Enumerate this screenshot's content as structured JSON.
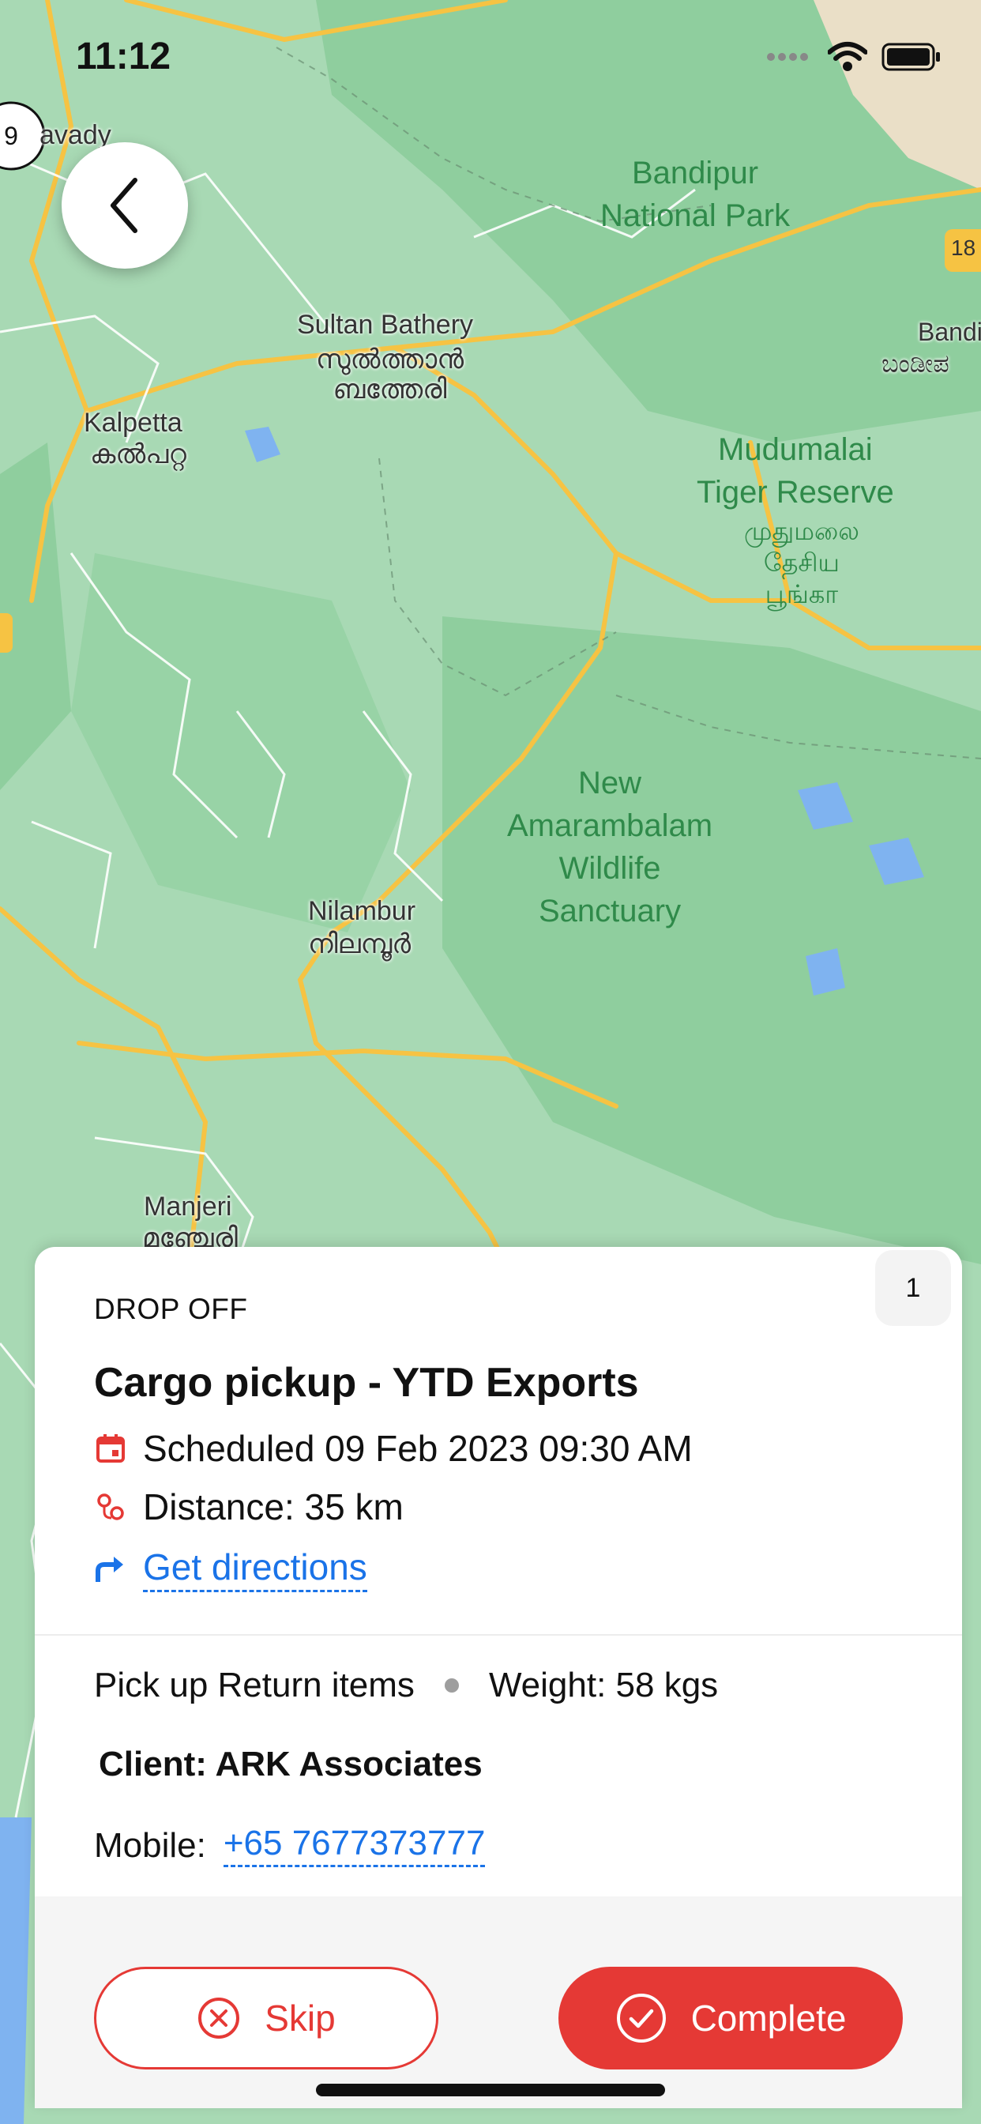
{
  "status_bar": {
    "time": "11:12"
  },
  "map": {
    "labels": {
      "bandipur_park": "Bandipur\nNational Park",
      "sultan_bathery": "Sultan Bathery",
      "sultan_bathery_ml": "സുൽത്താൻ\nബത്തേരി",
      "kalpetta": "Kalpetta",
      "kalpetta_ml": "കൽപറ്റ",
      "mudumalai": "Mudumalai\nTiger Reserve",
      "mudumalai_ta": "முதுமலை\nதேசிய\nபூங்கா",
      "new_amarambalam": "New\nAmarambalam\nWildlife\nSanctuary",
      "nilambur": "Nilambur",
      "nilambur_ml": "നിലമ്പൂർ",
      "manjeri": "Manjeri",
      "manjeri_ml": "മഞ്ചേരി",
      "mananthavady_fragment": "avady",
      "road_badge_9": "9",
      "bandipur_fragment": "Bandip",
      "bandipur_kn_fragment": "ಬಂಡೀಪ",
      "road_18_fragment": "18"
    },
    "colors": {
      "base": "#a8d9b4",
      "forest": "#8fce9e",
      "road": "#f6c343",
      "water": "#7fb3f0"
    }
  },
  "back_button": {
    "icon": "chevron-left-icon"
  },
  "card": {
    "stop_number": "1",
    "section_label": "DROP OFF",
    "title": "Cargo pickup - YTD Exports",
    "scheduled": "Scheduled 09 Feb 2023 09:30 AM",
    "distance": "Distance: 35 km",
    "directions_link": "Get directions",
    "task_type": "Pick up Return items",
    "weight": "Weight: 58 kgs",
    "client": "Client: ARK Associates",
    "mobile_label": "Mobile:",
    "mobile_number": "+65 7677373777"
  },
  "actions": {
    "skip_label": "Skip",
    "complete_label": "Complete"
  },
  "colors": {
    "accent": "#e53935",
    "link": "#1a73e8"
  }
}
